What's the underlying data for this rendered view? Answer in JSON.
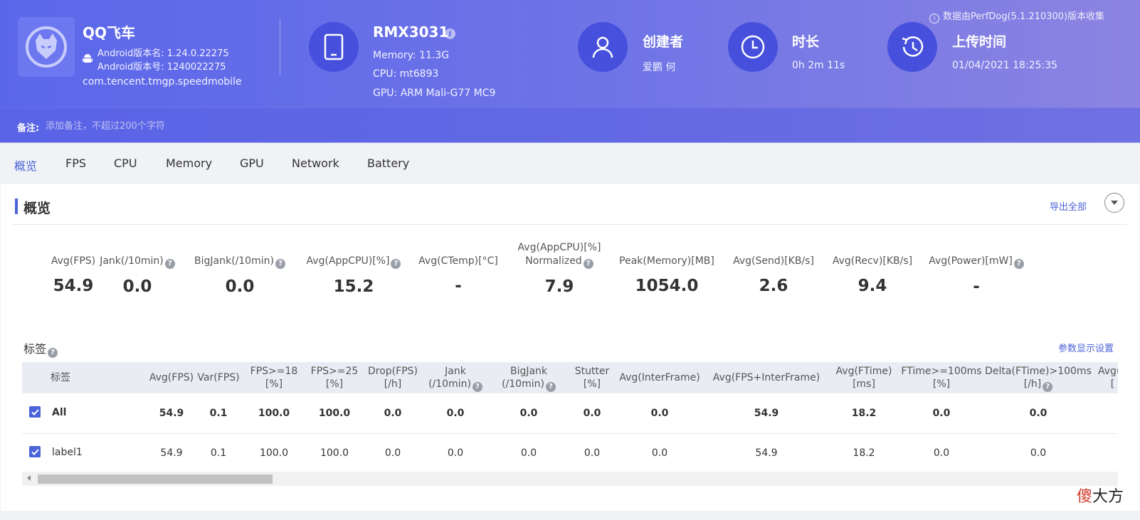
{
  "header": {
    "app": {
      "name": "QQ飞车",
      "android_version_name": "Android版本名: 1.24.0.22275",
      "android_version_code": "Android版本号: 1240022275",
      "package": "com.tencent.tmgp.speedmobile"
    },
    "device": {
      "name": "RMX3031",
      "memory": "Memory: 11.3G",
      "cpu": "CPU: mt6893",
      "gpu": "GPU: ARM Mali-G77 MC9"
    },
    "creator": {
      "title": "创建者",
      "value": "爱鹏 何"
    },
    "duration": {
      "title": "时长",
      "value": "0h 2m 11s"
    },
    "upload": {
      "title": "上传时间",
      "value": "01/04/2021 18:25:35"
    },
    "perfdog_note": "数据由PerfDog(5.1.210300)版本收集",
    "note": {
      "label": "备注:",
      "placeholder": "添加备注，不超过200个字符"
    }
  },
  "tabs": [
    "概览",
    "FPS",
    "CPU",
    "Memory",
    "GPU",
    "Network",
    "Battery"
  ],
  "active_tab": "概览",
  "panel": {
    "title": "概览",
    "export_label": "导出全部",
    "stats": [
      {
        "label": "Avg(FPS)",
        "value": "54.9"
      },
      {
        "label": "Jank(/10min)",
        "value": "0.0"
      },
      {
        "label": "BigJank(/10min)",
        "value": "0.0"
      },
      {
        "label": "Avg(AppCPU)[%]",
        "value": "15.2"
      },
      {
        "label": "Avg(CTemp)[°C]",
        "value": "-"
      },
      {
        "label": "Avg(AppCPU)[%]",
        "label2": "Normalized",
        "value": "7.9"
      },
      {
        "label": "Peak(Memory)[MB]",
        "value": "1054.0"
      },
      {
        "label": "Avg(Send)[KB/s]",
        "value": "2.6"
      },
      {
        "label": "Avg(Recv)[KB/s]",
        "value": "9.4"
      },
      {
        "label": "Avg(Power)[mW]",
        "value": "-"
      }
    ],
    "tags_title": "标签",
    "settings_label": "参数显示设置"
  },
  "table": {
    "columns": [
      {
        "l1": "标签"
      },
      {
        "l1": "Avg(FPS)"
      },
      {
        "l1": "Var(FPS)"
      },
      {
        "l1": "FPS>=18",
        "l2": "[%]"
      },
      {
        "l1": "FPS>=25",
        "l2": "[%]"
      },
      {
        "l1": "Drop(FPS)",
        "l2": "[/h]"
      },
      {
        "l1": "Jank",
        "l2": "(/10min)"
      },
      {
        "l1": "BigJank",
        "l2": "(/10min)"
      },
      {
        "l1": "Stutter",
        "l2": "[%]"
      },
      {
        "l1": "Avg(InterFrame)"
      },
      {
        "l1": "Avg(FPS+InterFrame)"
      },
      {
        "l1": "Avg(FTime)",
        "l2": "[ms]"
      },
      {
        "l1": "FTime>=100ms",
        "l2": "[%]"
      },
      {
        "l1": "Delta(FTime)>100ms",
        "l2": "[/h]"
      },
      {
        "l1": "Avg(A",
        "l2": "["
      }
    ],
    "rows": [
      {
        "label": "All",
        "checked": true,
        "values": [
          "54.9",
          "0.1",
          "100.0",
          "100.0",
          "0.0",
          "0.0",
          "0.0",
          "0.0",
          "0.0",
          "54.9",
          "18.2",
          "0.0",
          "0.0"
        ]
      },
      {
        "label": "label1",
        "checked": true,
        "values": [
          "54.9",
          "0.1",
          "100.0",
          "100.0",
          "0.0",
          "0.0",
          "0.0",
          "0.0",
          "0.0",
          "54.9",
          "18.2",
          "0.0",
          "0.0"
        ]
      }
    ]
  },
  "watermark": {
    "first": "傻",
    "rest": "大方"
  },
  "colors": {
    "accent": "#4b63d8",
    "header_start": "#5b67ea",
    "header_end": "#8b84e2",
    "circle": "#4650dd"
  }
}
